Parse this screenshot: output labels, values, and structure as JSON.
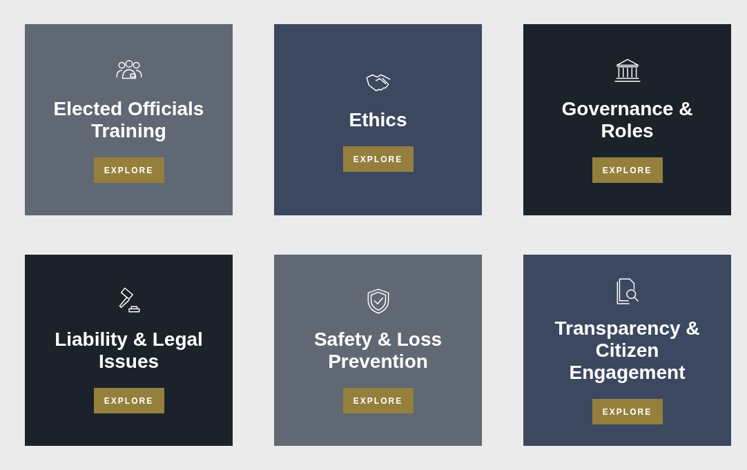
{
  "cards": [
    {
      "kind": "people",
      "title": "Elected Officials Training",
      "button": "EXPLORE",
      "color": "#5f6873"
    },
    {
      "kind": "handshake",
      "title": "Ethics",
      "button": "EXPLORE",
      "color": "#3c4860"
    },
    {
      "kind": "building",
      "title": "Governance & Roles",
      "button": "EXPLORE",
      "color": "#1c222a"
    },
    {
      "kind": "gavel",
      "title": "Liability & Legal Issues",
      "button": "EXPLORE",
      "color": "#1c222a"
    },
    {
      "kind": "shield",
      "title": "Safety & Loss Prevention",
      "button": "EXPLORE",
      "color": "#5f6873"
    },
    {
      "kind": "document",
      "title": "Transparency & Citizen Engagement",
      "button": "EXPLORE",
      "color": "#3c4860"
    }
  ]
}
